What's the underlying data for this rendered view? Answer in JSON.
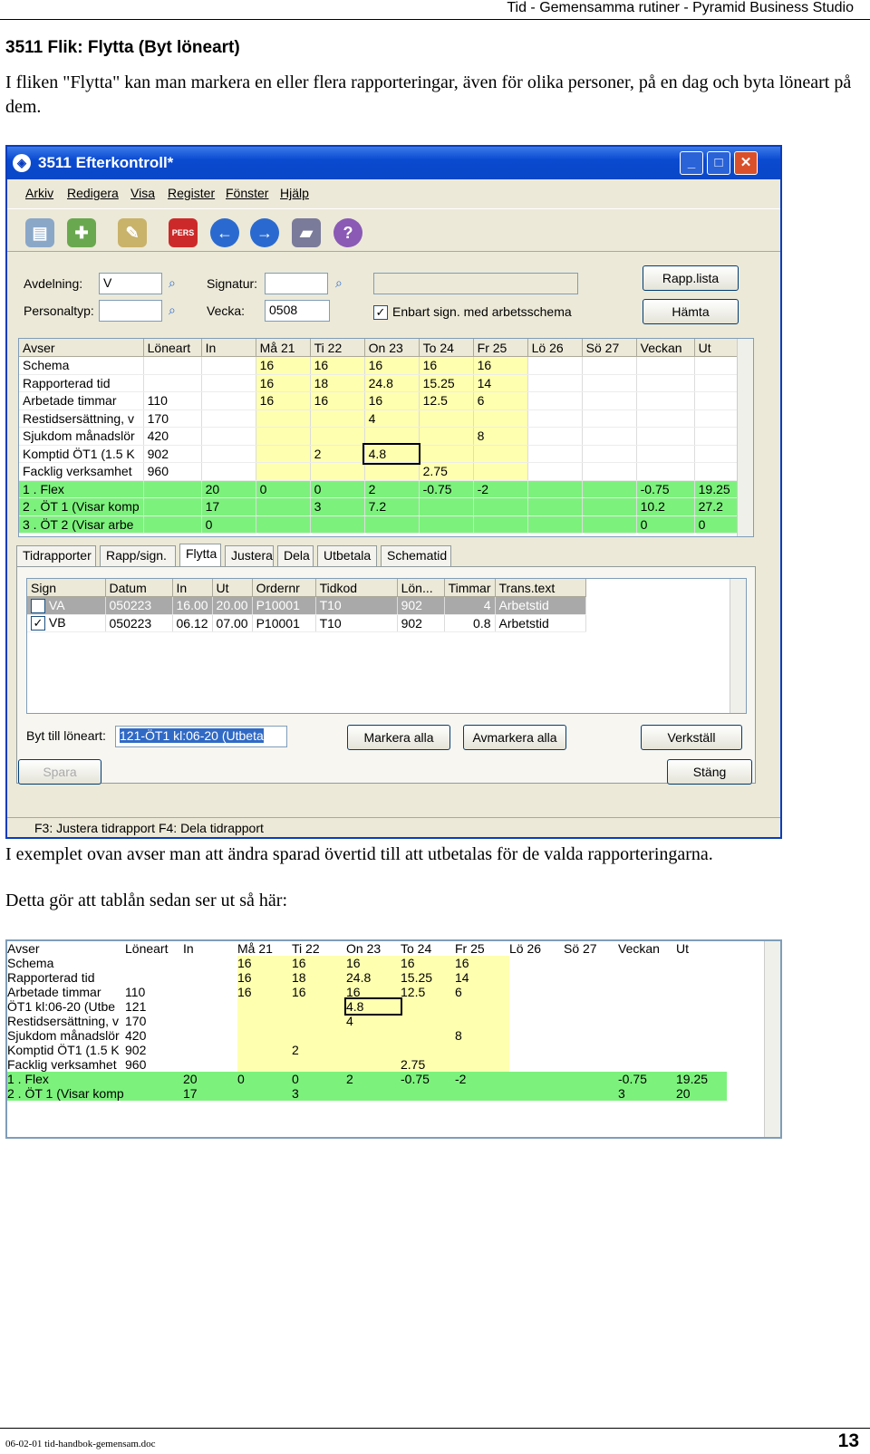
{
  "header": "Tid - Gemensamma rutiner - Pyramid Business Studio",
  "heading": "3511 Flik: Flytta (Byt löneart)",
  "intro": "I fliken \"Flytta\" kan man markera en eller flera rapporteringar, även för olika personer, på en dag och byta löneart på dem.",
  "para2": "I exemplet ovan avser man att ändra sparad övertid till att utbetalas för de valda rapporteringarna.",
  "para3": "Detta gör att tablån sedan ser ut så här:",
  "footer": {
    "left": "06-02-01 tid-handbok-gemensam.doc",
    "page": "13"
  },
  "window": {
    "title": "3511 Efterkontroll*",
    "menu": [
      "Arkiv",
      "Redigera",
      "Visa",
      "Register",
      "Fönster",
      "Hjälp"
    ],
    "form": {
      "avdelning_label": "Avdelning:",
      "avdelning": "V",
      "personaltyp_label": "Personaltyp:",
      "signatur_label": "Signatur:",
      "vecka_label": "Vecka:",
      "vecka": "0508",
      "checkbox_label": "Enbart sign. med arbetsschema",
      "rapp_lista": "Rapp.lista",
      "hamta": "Hämta"
    },
    "tabs": [
      "Tidrapporter",
      "Rapp/sign.",
      "Flytta",
      "Justera",
      "Dela",
      "Utbetala",
      "Schematid"
    ],
    "move_headers": [
      "Sign",
      "Datum",
      "In",
      "Ut",
      "Ordernr",
      "Tidkod",
      "Lön...",
      "Timmar",
      "Trans.text"
    ],
    "move_rows": [
      [
        "VA",
        "050223",
        "16.00",
        "20.00",
        "P10001",
        "T10",
        "902",
        "4",
        "Arbetstid"
      ],
      [
        "VB",
        "050223",
        "06.12",
        "07.00",
        "P10001",
        "T10",
        "902",
        "0.8",
        "Arbetstid"
      ]
    ],
    "byt_label": "Byt till löneart:",
    "byt_value": "121-ÖT1 kl:06-20 (Utbeta",
    "markera": "Markera alla",
    "avmarkera": "Avmarkera alla",
    "verkstall": "Verkställ",
    "spara": "Spara",
    "stang": "Stäng",
    "status": "F3: Justera tidrapport  F4: Dela tidrapport"
  },
  "grid_headers": [
    "Avser",
    "Löneart",
    "In",
    "Må 21",
    "Ti 22",
    "On 23",
    "To 24",
    "Fr 25",
    "Lö 26",
    "Sö 27",
    "Veckan",
    "Ut"
  ],
  "grid1": [
    [
      "Schema",
      "",
      "",
      "16",
      "16",
      "16",
      "16",
      "16",
      "",
      "",
      "",
      ""
    ],
    [
      "Rapporterad tid",
      "",
      "",
      "16",
      "18",
      "24.8",
      "15.25",
      "14",
      "",
      "",
      "",
      ""
    ],
    [
      "Arbetade timmar",
      "110",
      "",
      "16",
      "16",
      "16",
      "12.5",
      "6",
      "",
      "",
      "",
      ""
    ],
    [
      "Restidsersättning, v",
      "170",
      "",
      "",
      "",
      "4",
      "",
      "",
      "",
      "",
      "",
      ""
    ],
    [
      "Sjukdom månadslör",
      "420",
      "",
      "",
      "",
      "",
      "",
      "8",
      "",
      "",
      "",
      ""
    ],
    [
      "Komptid ÖT1 (1.5 K",
      "902",
      "",
      "",
      "2",
      "4.8",
      "",
      "",
      "",
      "",
      "",
      ""
    ],
    [
      "Facklig verksamhet",
      "960",
      "",
      "",
      "",
      "",
      "2.75",
      "",
      "",
      "",
      "",
      ""
    ],
    [
      "1 . Flex",
      "",
      "20",
      "0",
      "0",
      "2",
      "-0.75",
      "-2",
      "",
      "",
      "-0.75",
      "19.25"
    ],
    [
      "2 . ÖT 1 (Visar komp",
      "",
      "17",
      "",
      "3",
      "7.2",
      "",
      "",
      "",
      "",
      "10.2",
      "27.2"
    ],
    [
      "3 . ÖT 2 (Visar arbe",
      "",
      "0",
      "",
      "",
      "",
      "",
      "",
      "",
      "",
      "0",
      "0"
    ]
  ],
  "grid2": [
    [
      "Schema",
      "",
      "",
      "16",
      "16",
      "16",
      "16",
      "16",
      "",
      "",
      "",
      ""
    ],
    [
      "Rapporterad tid",
      "",
      "",
      "16",
      "18",
      "24.8",
      "15.25",
      "14",
      "",
      "",
      "",
      ""
    ],
    [
      "Arbetade timmar",
      "110",
      "",
      "16",
      "16",
      "16",
      "12.5",
      "6",
      "",
      "",
      "",
      ""
    ],
    [
      "ÖT1 kl:06-20 (Utbe",
      "121",
      "",
      "",
      "",
      "4.8",
      "",
      "",
      "",
      "",
      "",
      ""
    ],
    [
      "Restidsersättning, v",
      "170",
      "",
      "",
      "",
      "4",
      "",
      "",
      "",
      "",
      "",
      ""
    ],
    [
      "Sjukdom månadslör",
      "420",
      "",
      "",
      "",
      "",
      "",
      "8",
      "",
      "",
      "",
      ""
    ],
    [
      "Komptid ÖT1 (1.5 K",
      "902",
      "",
      "",
      "2",
      "",
      "",
      "",
      "",
      "",
      "",
      ""
    ],
    [
      "Facklig verksamhet",
      "960",
      "",
      "",
      "",
      "",
      "2.75",
      "",
      "",
      "",
      "",
      ""
    ],
    [
      "1 . Flex",
      "",
      "20",
      "0",
      "0",
      "2",
      "-0.75",
      "-2",
      "",
      "",
      "-0.75",
      "19.25"
    ],
    [
      "2 . ÖT 1 (Visar komp",
      "",
      "17",
      "",
      "3",
      "",
      "",
      "",
      "",
      "",
      "3",
      "20"
    ]
  ]
}
